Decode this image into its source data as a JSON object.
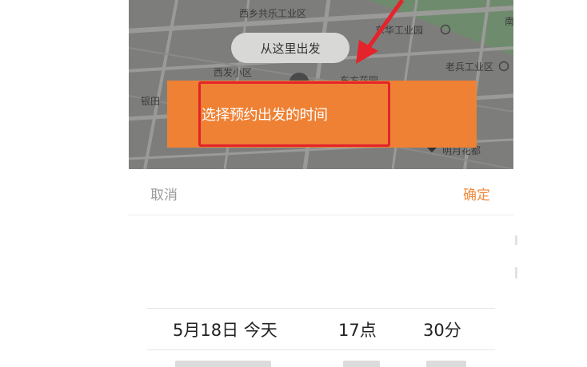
{
  "map": {
    "labels": {
      "xixiang_gongye": "西乡共乐工业区",
      "gongye_yuan": "东华工业园",
      "xifa": "西发小区",
      "laobing": "老兵工业区",
      "yintian": "银田",
      "dongfang": "东方花园",
      "mingyue": "明月花都",
      "nan": "南"
    },
    "start_label": "从这里出发"
  },
  "tooltip": {
    "text": "选择预约出发的时间"
  },
  "picker": {
    "cancel_label": "取消",
    "confirm_label": "确定",
    "selected_date": "5月18日 今天",
    "selected_hour": "17点",
    "selected_minute": "30分"
  },
  "colors": {
    "accent": "#ef8134",
    "highlight": "#e4232b",
    "confirm": "#f08a3c"
  }
}
